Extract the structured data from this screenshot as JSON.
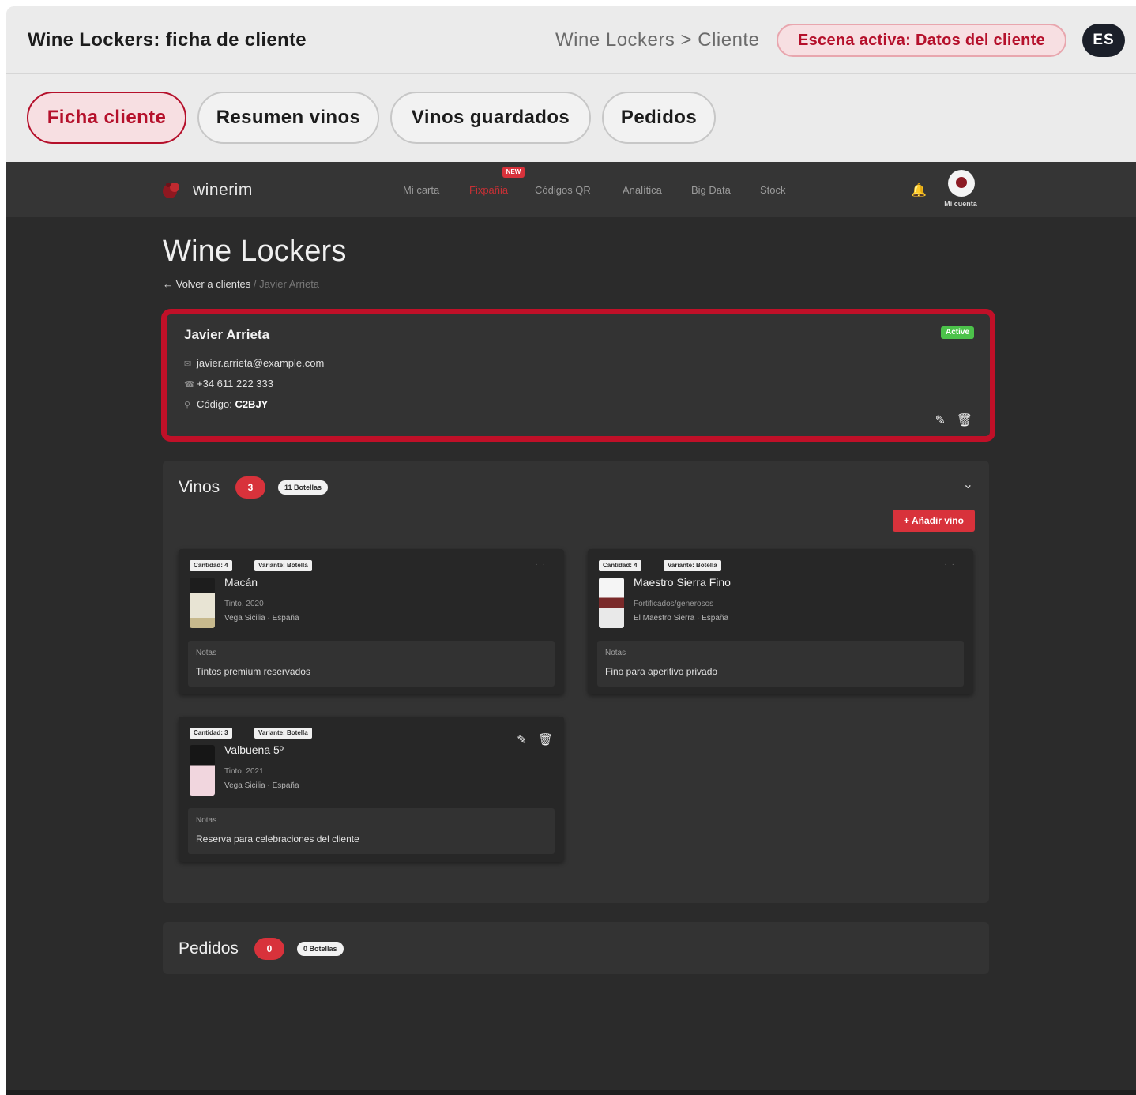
{
  "header": {
    "title": "Wine Lockers: ficha de cliente",
    "breadcrumb": "Wine Lockers > Cliente",
    "scene": "Escena activa: Datos del cliente",
    "lang": "ES"
  },
  "tabs": [
    {
      "label": "Ficha cliente",
      "active": true
    },
    {
      "label": "Resumen vinos",
      "active": false
    },
    {
      "label": "Vinos guardados",
      "active": false
    },
    {
      "label": "Pedidos",
      "active": false
    }
  ],
  "app": {
    "logo": "winerim",
    "nav": [
      {
        "label": "Mi carta"
      },
      {
        "label": "Fixpañia",
        "active": true,
        "badge": "NEW"
      },
      {
        "label": "Códigos QR"
      },
      {
        "label": "Analítica"
      },
      {
        "label": "Big Data"
      },
      {
        "label": "Stock"
      }
    ],
    "account_label": "Mi cuenta",
    "page_title": "Wine Lockers",
    "back_label": "Volver a clientes",
    "breadcrumb_sep": "/",
    "breadcrumb_current": "Javier Arrieta"
  },
  "client": {
    "name": "Javier Arrieta",
    "status": "Active",
    "email": "javier.arrieta@example.com",
    "phone": "+34 611 222 333",
    "code_label": "Código:",
    "code": "C2BJY"
  },
  "wines_section": {
    "title": "Vinos",
    "count": "3",
    "bottles": "11 Botellas",
    "add_label": "+ Añadir vino",
    "cards": [
      {
        "tag_qty": "Cantidad: 4",
        "tag_variant": "Variante: Botella",
        "name": "Macán",
        "sub1": "Tinto, 2020",
        "sub2": "Vega Sicilia · España",
        "notes_label": "Notas",
        "notes": "Tintos premium reservados"
      },
      {
        "tag_qty": "Cantidad: 4",
        "tag_variant": "Variante: Botella",
        "name": "Maestro Sierra Fino",
        "sub1": "Fortificados/generosos",
        "sub2": "El Maestro Sierra · España",
        "notes_label": "Notas",
        "notes": "Fino para aperitivo privado"
      },
      {
        "tag_qty": "Cantidad: 3",
        "tag_variant": "Variante: Botella",
        "name": "Valbuena 5º",
        "sub1": "Tinto, 2021",
        "sub2": "Vega Sicilia · España",
        "notes_label": "Notas",
        "notes": "Reserva para celebraciones del cliente"
      }
    ]
  },
  "orders_section": {
    "title": "Pedidos",
    "count": "0",
    "bottles": "0 Botellas"
  },
  "icons": {
    "email": "mail-icon",
    "phone": "phone-icon",
    "code": "key-icon",
    "edit": "pencil-icon",
    "delete": "trash-icon",
    "chevron": "chevron-down-icon",
    "bell": "bell-icon"
  },
  "colors": {
    "accent": "#b5102b",
    "app_red": "#d8323b",
    "active_green": "#4cc24a",
    "app_bg": "#2b2b2b"
  }
}
